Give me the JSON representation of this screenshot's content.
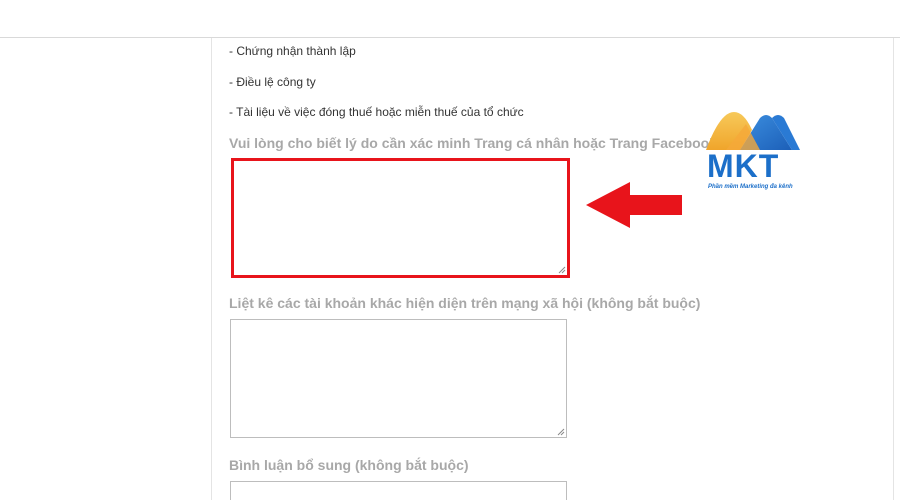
{
  "documents": [
    "- Chứng nhận thành lập",
    "- Điều lệ công ty",
    "- Tài liệu về việc đóng thuế hoặc miễn thuế của tổ chức"
  ],
  "fields": {
    "reason": {
      "label": "Vui lòng cho biết lý do cần xác minh Trang cá nhân hoặc Trang Facebook",
      "value": ""
    },
    "social_accounts": {
      "label": "Liệt kê các tài khoản khác hiện diện trên mạng xã hội (không bắt buộc)",
      "value": ""
    },
    "comments": {
      "label": "Bình luận bổ sung (không bắt buộc)",
      "value": ""
    }
  },
  "logo": {
    "name": "MKT",
    "tagline": "Phần mềm Marketing đa kênh"
  },
  "colors": {
    "highlight": "#e8141b",
    "label": "#a8a8a8",
    "logo_blue": "#1c6fc9",
    "logo_yellow": "#f5b53c"
  },
  "icons": {
    "arrow": "arrow-left-icon"
  }
}
